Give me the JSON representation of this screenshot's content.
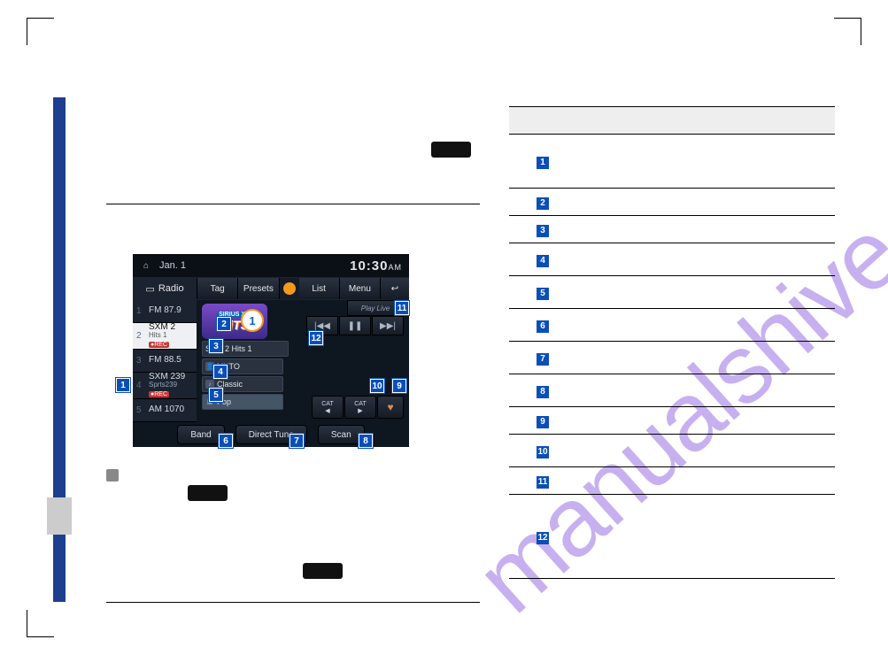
{
  "watermark": "manualshive.com",
  "device": {
    "statusbar": {
      "date": "Jan. 1",
      "time": "10:30",
      "ampm": "AM"
    },
    "toolbar": {
      "radio": "Radio",
      "tag": "Tag",
      "presets": "Presets",
      "list": "List",
      "menu": "Menu"
    },
    "presets": [
      {
        "num": "1",
        "label": "FM 87.9"
      },
      {
        "num": "2",
        "label": "SXM 2",
        "sub": "Hits 1",
        "rec": "●REC",
        "active": true
      },
      {
        "num": "3",
        "label": "FM 88.5"
      },
      {
        "num": "4",
        "label": "SXM 239",
        "sub": "Sprts239",
        "rec": "●REC"
      },
      {
        "num": "5",
        "label": "AM 1070"
      }
    ],
    "logo": {
      "brand": "SIRIUS XM",
      "line": "HiTS",
      "badge": "1"
    },
    "channel": "SXM 2   Hits 1",
    "artist": "MKTO",
    "song": "Classic",
    "category": "Pop",
    "playlive": "Play Live",
    "cat_prev": "CAT",
    "cat_next": "CAT",
    "band": "Band",
    "direct": "Direct Tune",
    "scan": "Scan"
  },
  "callouts": [
    "1",
    "2",
    "3",
    "4",
    "5",
    "6",
    "7",
    "8",
    "9",
    "10",
    "11",
    "12"
  ],
  "table_rows": [
    "1",
    "2",
    "3",
    "4",
    "5",
    "6",
    "7",
    "8",
    "9",
    "10",
    "11",
    "12"
  ]
}
